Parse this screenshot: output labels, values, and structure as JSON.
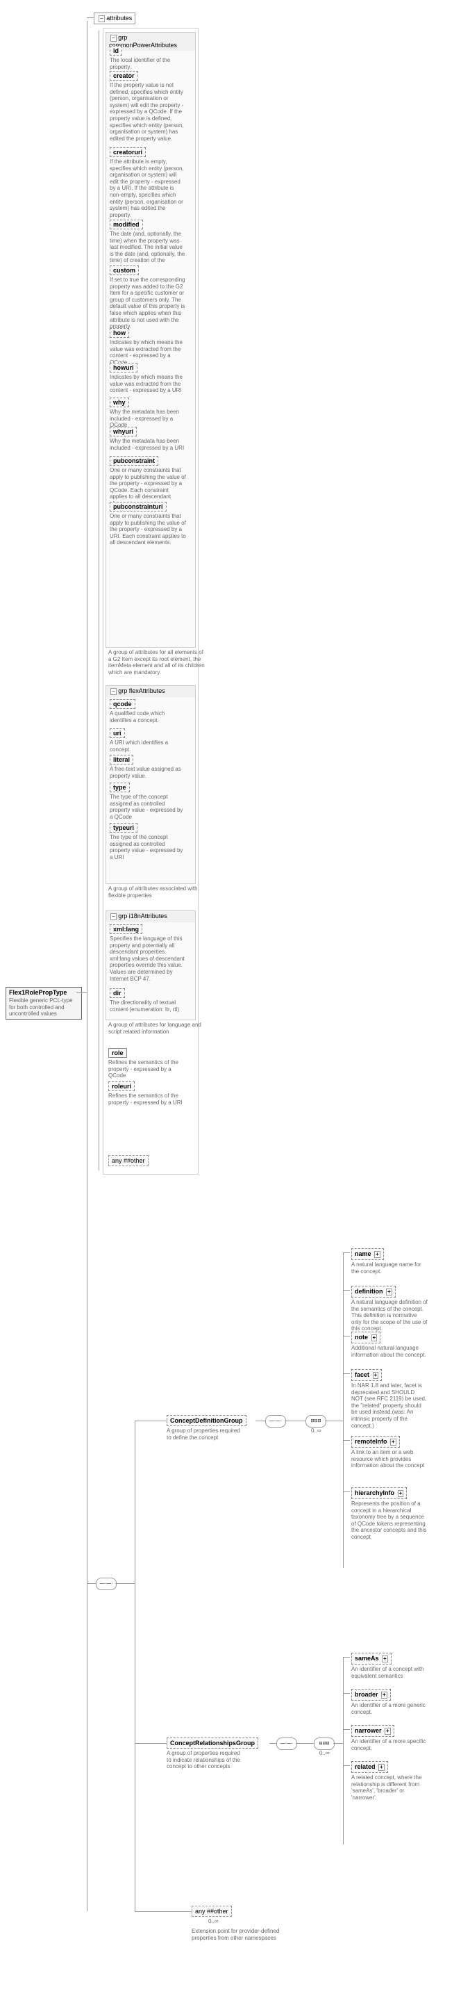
{
  "root": {
    "name": "Flex1RolePropType",
    "desc": "Flexible generic PCL-type for both controlled and uncontrolled values"
  },
  "attributes_label": "attributes",
  "groups": {
    "commonPower": {
      "label": "grp  commonPowerAttributes",
      "desc": "A group of attributes for all elements of a G2 Item except its root element, the itemMeta element and all of its children which are mandatory.",
      "items": [
        {
          "name": "id",
          "desc": "The local identifier of the property."
        },
        {
          "name": "creator",
          "desc": "If the property value is not defined, specifies which entity (person, organisation or system) will edit the property - expressed by a QCode. If the property value is defined, specifies which entity (person, organisation or system) has edited the property value."
        },
        {
          "name": "creatoruri",
          "desc": "If the attribute is empty, specifies which entity (person, organisation or system) will edit the property - expressed by a URI. If the attribute is non-empty, specifies which entity (person, organisation or system) has edited the property."
        },
        {
          "name": "modified",
          "desc": "The date (and, optionally, the time) when the property was last modified. The initial value is the date (and, optionally, the time) of creation of the property."
        },
        {
          "name": "custom",
          "desc": "If set to true the corresponding property was added to the G2 Item for a specific customer or group of customers only. The default value of this property is false which applies when this attribute is not used with the property."
        },
        {
          "name": "how",
          "desc": "Indicates by which means the value was extracted from the content - expressed by a QCode"
        },
        {
          "name": "howuri",
          "desc": "Indicates by which means the value was extracted from the content - expressed by a URI"
        },
        {
          "name": "why",
          "desc": "Why the metadata has been included - expressed by a QCode"
        },
        {
          "name": "whyuri",
          "desc": "Why the metadata has been included - expressed by a URI"
        },
        {
          "name": "pubconstraint",
          "desc": "One or many constraints that apply to publishing the value of the property - expressed by a QCode. Each constraint applies to all descendant elements."
        },
        {
          "name": "pubconstrainturi",
          "desc": "One or many constraints that apply to publishing the value of the property - expressed by a URI. Each constraint applies to all descendant elements."
        }
      ]
    },
    "flex": {
      "label": "grp  flexAttributes",
      "desc": "A group of attributes associated with flexible properties",
      "items": [
        {
          "name": "qcode",
          "desc": "A qualified code which identifies a concept."
        },
        {
          "name": "uri",
          "desc": "A URI which identifies a concept."
        },
        {
          "name": "literal",
          "desc": "A free-text value assigned as property value."
        },
        {
          "name": "type",
          "desc": "The type of the concept assigned as controlled property value - expressed by a QCode"
        },
        {
          "name": "typeuri",
          "desc": "The type of the concept assigned as controlled property value - expressed by a URI"
        }
      ]
    },
    "i18n": {
      "label": "grp  i18nAttributes",
      "desc": "A group of attributes for language and script related information",
      "items": [
        {
          "name": "xml:lang",
          "desc": "Specifies the language of this property and potentially all descendant properties. xml:lang values of descendant properties override this value. Values are determined by Internet BCP 47."
        },
        {
          "name": "dir",
          "desc": "The directionality of textual content (enumeration: ltr, rtl)"
        }
      ]
    }
  },
  "role": {
    "name": "role",
    "desc": "Refines the semantics of the property - expressed by a QCode"
  },
  "roleuri": {
    "name": "roleuri",
    "desc": "Refines the semantics of the property - expressed by a URI"
  },
  "any_other": {
    "label": "any ##other"
  },
  "conceptDef": {
    "name": "ConceptDefinitionGroup",
    "desc": "A group of properties required to define the concept",
    "items": [
      {
        "name": "name",
        "desc": "A natural language name for the concept."
      },
      {
        "name": "definition",
        "desc": "A natural language definition of the semantics of the concept. This definition is normative only for the scope of the use of this concept."
      },
      {
        "name": "note",
        "desc": "Additional natural language information about the concept."
      },
      {
        "name": "facet",
        "desc": "In NAR 1.8 and later, facet is deprecated and SHOULD NOT (see RFC 2119) be used, the \"related\" property should be used instead.(was: An intrinsic property of the concept.)"
      },
      {
        "name": "remoteInfo",
        "desc": "A link to an item or a web resource which provides information about the concept"
      },
      {
        "name": "hierarchyInfo",
        "desc": "Represents the position of a concept in a hierarchical taxonomy tree by a sequence of QCode tokens representing the ancestor concepts and this concept"
      }
    ]
  },
  "conceptRel": {
    "name": "ConceptRelationshipsGroup",
    "desc": "A group of properties required to indicate relationships of the concept to other concepts",
    "items": [
      {
        "name": "sameAs",
        "desc": "An identifier of a concept with equivalent semantics"
      },
      {
        "name": "broader",
        "desc": "An identifier of a more generic concept."
      },
      {
        "name": "narrower",
        "desc": "An identifier of a more specific concept."
      },
      {
        "name": "related",
        "desc": "A related concept, where the relationship is different from 'sameAs', 'broader' or 'narrower'."
      }
    ]
  },
  "any_bottom": {
    "label": "any ##other",
    "occ": "0..∞",
    "desc": "Extension point for provider-defined properties from other namespaces"
  },
  "occ_labels": {
    "zero_inf": "0..∞"
  }
}
